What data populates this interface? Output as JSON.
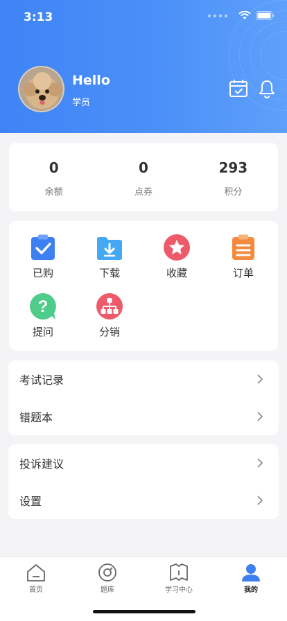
{
  "status": {
    "time": "3:13"
  },
  "profile": {
    "greeting": "Hello",
    "role": "学员"
  },
  "stats": [
    {
      "value": "0",
      "label": "余额"
    },
    {
      "value": "0",
      "label": "点券"
    },
    {
      "value": "293",
      "label": "积分"
    }
  ],
  "features": [
    {
      "label": "已购",
      "icon": "clipboard-check-icon",
      "color": "#3e7ff2"
    },
    {
      "label": "下载",
      "icon": "folder-download-icon",
      "color": "#45a8f5"
    },
    {
      "label": "收藏",
      "icon": "star-icon",
      "color": "#ee5a6a"
    },
    {
      "label": "订单",
      "icon": "order-list-icon",
      "color": "#f58a3c"
    },
    {
      "label": "提问",
      "icon": "question-icon",
      "color": "#4fcb8a"
    },
    {
      "label": "分销",
      "icon": "distribution-icon",
      "color": "#ee5a6a"
    }
  ],
  "list_group_1": [
    {
      "label": "考试记录"
    },
    {
      "label": "错题本"
    }
  ],
  "list_group_2": [
    {
      "label": "投诉建议"
    },
    {
      "label": "设置"
    }
  ],
  "tabbar": [
    {
      "label": "首页",
      "icon": "home-icon",
      "active": false
    },
    {
      "label": "题库",
      "icon": "question-bank-icon",
      "active": false
    },
    {
      "label": "学习中心",
      "icon": "book-icon",
      "active": false
    },
    {
      "label": "我的",
      "icon": "user-icon",
      "active": true
    }
  ],
  "colors": {
    "header_start": "#3f84f6",
    "header_end": "#5ea0fb",
    "accent": "#3e7ff2"
  }
}
